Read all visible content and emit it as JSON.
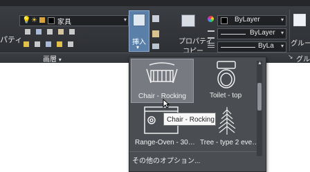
{
  "ribbon": {
    "left_partial_label": "パティ",
    "layer_name": "家具",
    "layers_panel_label": "画層",
    "insert_label": "挿入",
    "properties_label_line1": "プロパティ",
    "properties_label_line2": "コピー",
    "color_value": "ByLayer",
    "linetype_value": "ByLayer",
    "lineweight_value": "ByLa",
    "group_label": "グルー",
    "group_panel_label": "グルー",
    "colors": {
      "ribbon_bg": "#2f3236",
      "gallery_bg": "#4a4d52",
      "accent_blue": "#3d7fd6"
    }
  },
  "gallery": {
    "items": [
      {
        "label": "Chair - Rocking",
        "icon": "rocking-chair-icon"
      },
      {
        "label": "Toilet - top",
        "icon": "toilet-icon"
      },
      {
        "label": "Range-Oven - 30…",
        "icon": "range-oven-icon"
      },
      {
        "label": "Tree - type 2 eve…",
        "icon": "tree-icon"
      }
    ],
    "more_options": "その他のオプション..."
  },
  "tooltip": {
    "text": "Chair - Rocking"
  }
}
